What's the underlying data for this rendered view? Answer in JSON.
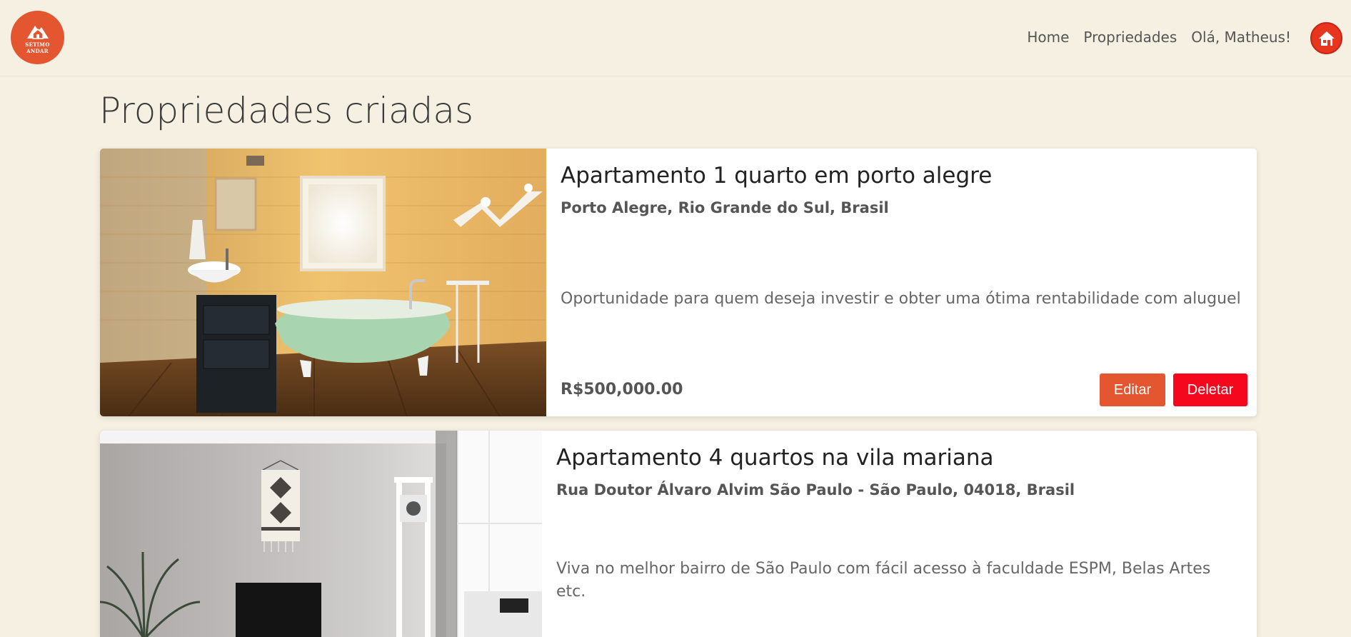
{
  "brand": {
    "logo_line1": "SÉTIMO",
    "logo_line2": "ANDAR"
  },
  "nav": {
    "home": "Home",
    "properties": "Propriedades",
    "greeting": "Olá, Matheus!"
  },
  "page": {
    "title": "Propriedades criadas"
  },
  "properties": [
    {
      "title": "Apartamento 1 quarto em porto alegre",
      "address": "Porto Alegre, Rio Grande do Sul, Brasil",
      "description": "Oportunidade para quem deseja investir e obter uma ótima rentabilidade com aluguel",
      "price": "R$500,000.00",
      "edit_label": "Editar",
      "delete_label": "Deletar"
    },
    {
      "title": "Apartamento 4 quartos na vila mariana",
      "address": "Rua Doutor Álvaro Alvim São Paulo - São Paulo, 04018, Brasil",
      "description": "Viva no melhor bairro de São Paulo com fácil acesso à faculdade ESPM, Belas Artes etc."
    }
  ],
  "colors": {
    "background": "#f5f0e1",
    "accent": "#e4562f",
    "danger": "#f5081d"
  }
}
